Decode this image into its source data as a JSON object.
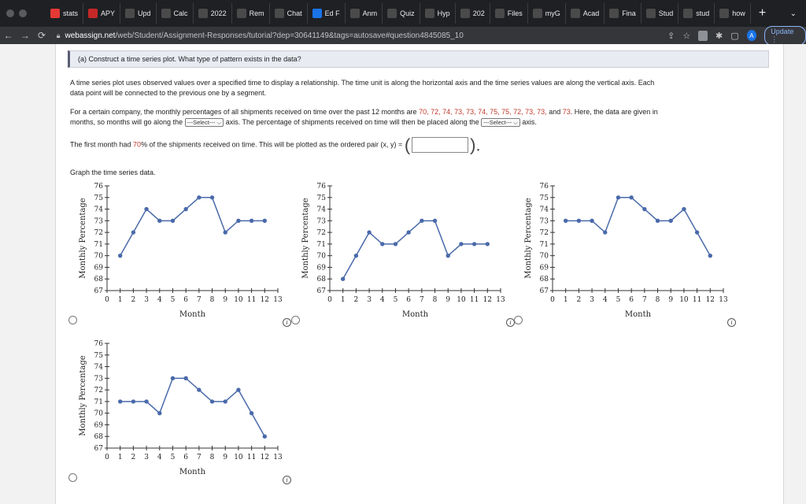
{
  "browser": {
    "tabs": [
      {
        "label": "stats",
        "icon": "youtube-icon",
        "color": "#e53935"
      },
      {
        "label": "APY",
        "icon": "sy-icon",
        "color": "#c62828"
      },
      {
        "label": "Upd",
        "icon": "gmail-icon",
        "color": "#4a4a4a"
      },
      {
        "label": "Calc",
        "icon": "openai-icon",
        "color": "#4a4a4a"
      },
      {
        "label": "2022",
        "icon": "openai-icon",
        "color": "#4a4a4a"
      },
      {
        "label": "Rem",
        "icon": "openai-icon",
        "color": "#4a4a4a"
      },
      {
        "label": "Chat",
        "icon": "openai-icon",
        "color": "#4a4a4a"
      },
      {
        "label": "Ed F",
        "icon": "search-icon",
        "color": "#1a73e8"
      },
      {
        "label": "Anm",
        "icon": "openai-icon",
        "color": "#4a4a4a"
      },
      {
        "label": "Quiz",
        "icon": "openai-icon",
        "color": "#4a4a4a"
      },
      {
        "label": "Hyp",
        "icon": "openai-icon",
        "color": "#4a4a4a"
      },
      {
        "label": "202",
        "icon": "openai-icon",
        "color": "#4a4a4a"
      },
      {
        "label": "Files",
        "icon": "openai-icon",
        "color": "#4a4a4a"
      },
      {
        "label": "myG",
        "icon": "google-icon",
        "color": "#4a4a4a"
      },
      {
        "label": "Acad",
        "icon": "google-icon",
        "color": "#4a4a4a"
      },
      {
        "label": "Fina",
        "icon": "google-icon",
        "color": "#4a4a4a"
      },
      {
        "label": "Stud",
        "icon": "chatgpt-icon",
        "color": "#4a4a4a"
      },
      {
        "label": "stud",
        "icon": "studocu-icon",
        "color": "#4a4a4a"
      },
      {
        "label": "how",
        "icon": "google-icon",
        "color": "#4a4a4a"
      }
    ],
    "url_host": "webassign.net",
    "url_path": "/web/Student/Assignment-Responses/tutorial?dep=30641149&tags=autosave#question4845085_10",
    "avatar_letter": "A",
    "update_label": "Update"
  },
  "question": {
    "header": "(a)   Construct a time series plot. What type of pattern exists in the data?",
    "intro_line1": "A time series plot uses observed values over a specified time to display a relationship. The time unit is along the horizontal axis and the time series values are along the vertical axis. Each",
    "intro_line2": "data point will be connected to the previous one by a segment.",
    "data_pre": "For a certain company, the monthly percentages of all shipments received on time over the past 12 months are ",
    "data_values": "70, 72, 74, 73, 73, 74, 75, 75, 72, 73, 73,",
    "data_and": " and ",
    "data_last": "73",
    "data_post": ". Here, the data are given in",
    "months_pre": "months, so months will go along the ",
    "select_label": "---Select---",
    "months_mid": " axis. The percentage of shipments received on time will then be placed along the ",
    "months_post": " axis.",
    "first_pre": "The first month had ",
    "first_value": "70",
    "first_post": "% of the shipments received on time. This will be plotted as the ordered pair (x, y) =",
    "graph_prompt": "Graph the time series data."
  },
  "chart_data": [
    {
      "type": "line",
      "xlabel": "Month",
      "ylabel": "Monthly Percentage",
      "xlim": [
        0,
        13
      ],
      "ylim": [
        67,
        76
      ],
      "x_ticks": [
        0,
        1,
        2,
        3,
        4,
        5,
        6,
        7,
        8,
        9,
        10,
        11,
        12,
        13
      ],
      "y_ticks": [
        67,
        68,
        69,
        70,
        71,
        72,
        73,
        74,
        75,
        76
      ],
      "x": [
        1,
        2,
        3,
        4,
        5,
        6,
        7,
        8,
        9,
        10,
        11,
        12
      ],
      "y": [
        70,
        72,
        74,
        73,
        73,
        74,
        75,
        75,
        72,
        73,
        73,
        73
      ]
    },
    {
      "type": "line",
      "xlabel": "Month",
      "ylabel": "Monthly Percentage",
      "xlim": [
        0,
        13
      ],
      "ylim": [
        67,
        76
      ],
      "x_ticks": [
        0,
        1,
        2,
        3,
        4,
        5,
        6,
        7,
        8,
        9,
        10,
        11,
        12,
        13
      ],
      "y_ticks": [
        67,
        68,
        69,
        70,
        71,
        72,
        73,
        74,
        75,
        76
      ],
      "x": [
        1,
        2,
        3,
        4,
        5,
        6,
        7,
        8,
        9,
        10,
        11,
        12
      ],
      "y": [
        68,
        70,
        72,
        71,
        71,
        72,
        73,
        73,
        70,
        71,
        71,
        71
      ]
    },
    {
      "type": "line",
      "xlabel": "Month",
      "ylabel": "Monthly Percentage",
      "xlim": [
        0,
        13
      ],
      "ylim": [
        67,
        76
      ],
      "x_ticks": [
        0,
        1,
        2,
        3,
        4,
        5,
        6,
        7,
        8,
        9,
        10,
        11,
        12,
        13
      ],
      "y_ticks": [
        67,
        68,
        69,
        70,
        71,
        72,
        73,
        74,
        75,
        76
      ],
      "x": [
        1,
        2,
        3,
        4,
        5,
        6,
        7,
        8,
        9,
        10,
        11,
        12
      ],
      "y": [
        73,
        73,
        73,
        72,
        75,
        75,
        74,
        73,
        73,
        74,
        72,
        70
      ]
    },
    {
      "type": "line",
      "xlabel": "Month",
      "ylabel": "Monthly Percentage",
      "xlim": [
        0,
        13
      ],
      "ylim": [
        67,
        76
      ],
      "x_ticks": [
        0,
        1,
        2,
        3,
        4,
        5,
        6,
        7,
        8,
        9,
        10,
        11,
        12,
        13
      ],
      "y_ticks": [
        67,
        68,
        69,
        70,
        71,
        72,
        73,
        74,
        75,
        76
      ],
      "x": [
        1,
        2,
        3,
        4,
        5,
        6,
        7,
        8,
        9,
        10,
        11,
        12
      ],
      "y": [
        71,
        71,
        71,
        70,
        73,
        73,
        72,
        71,
        71,
        72,
        70,
        68
      ]
    }
  ],
  "colors": {
    "line": "#4a6aaa",
    "point": "#4a6aaa",
    "highlight": "#c0392b"
  }
}
